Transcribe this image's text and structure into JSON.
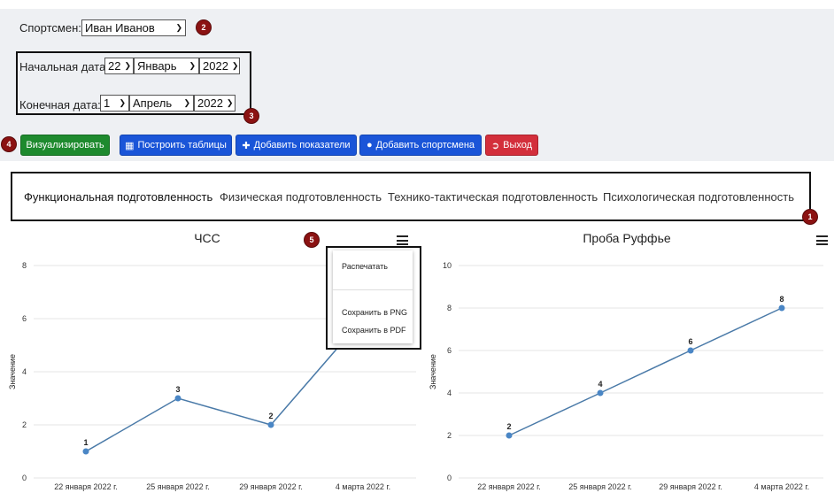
{
  "athlete": {
    "label": "Спортсмен:",
    "value": "Иван Иванов"
  },
  "dates": {
    "start_label": "Начальная дата:",
    "start_day": "22",
    "start_month": "Январь",
    "start_year": "2022",
    "end_label": "Конечная дата:",
    "end_day": "1",
    "end_month": "Апрель",
    "end_year": "2022"
  },
  "buttons": {
    "visualize": "Визуализировать",
    "tables": "Построить таблицы",
    "add_indicators": "Добавить показатели",
    "add_athlete": "Добавить спортсмена",
    "exit": "Выход"
  },
  "icons": {
    "tables": "table-icon",
    "add_indicators": "plus-icon",
    "add_athlete": "user-icon",
    "exit": "sign-out-icon",
    "menu": "hamburger-menu-icon"
  },
  "badges": [
    "1",
    "2",
    "3",
    "4",
    "5"
  ],
  "tabs": [
    "Функциональная подготовленность",
    "Физическая подготовленность",
    "Технико-тактическая подготовленность",
    "Психологическая подготовленность"
  ],
  "export_menu": {
    "print": "Распечатать",
    "png": "Сохранить в PNG",
    "pdf": "Сохранить в PDF"
  },
  "colors": {
    "line": "#4a7aa8",
    "point": "#4a86c5",
    "badge": "#8b1212",
    "green": "#1e8a2e",
    "blue": "#1a55d8",
    "red": "#d32f3b"
  },
  "chart_data": [
    {
      "type": "line",
      "title": "ЧСС",
      "ylabel": "Значение",
      "categories": [
        "22 января 2022 г.",
        "25 января 2022 г.",
        "29 января 2022 г.",
        "4 марта 2022 г."
      ],
      "values": [
        1,
        3,
        2,
        6
      ],
      "data_labels": [
        "1",
        "3",
        "2",
        ""
      ],
      "yticks": [
        0,
        2,
        4,
        6,
        8
      ],
      "ylim": [
        0,
        8
      ],
      "grid": true
    },
    {
      "type": "line",
      "title": "Проба Руффье",
      "ylabel": "Значение",
      "categories": [
        "22 января 2022 г.",
        "25 января 2022 г.",
        "29 января 2022 г.",
        "4 марта 2022 г."
      ],
      "values": [
        2,
        4,
        6,
        8
      ],
      "data_labels": [
        "2",
        "4",
        "6",
        "8"
      ],
      "yticks": [
        0,
        2,
        4,
        6,
        8,
        10
      ],
      "ylim": [
        0,
        10
      ],
      "grid": true
    }
  ]
}
